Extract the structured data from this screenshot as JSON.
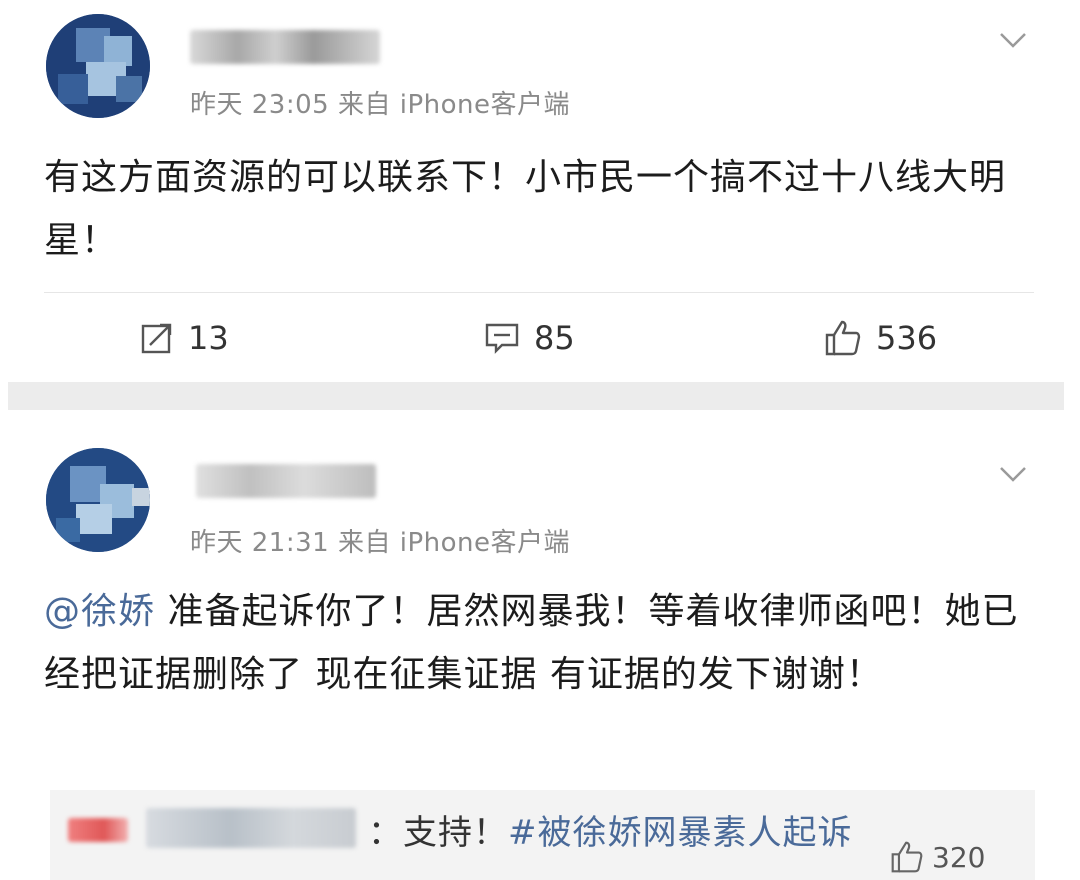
{
  "posts": [
    {
      "meta": "昨天 23:05  来自 iPhone客户端",
      "body": "有这方面资源的可以联系下！小市民一个搞不过十八线大明星！",
      "actions": {
        "repost_count": "13",
        "comment_count": "85",
        "like_count": "536"
      }
    },
    {
      "meta": "昨天 21:31  来自 iPhone客户端",
      "mention": "@徐娇",
      "body": " 准备起诉你了！居然网暴我！等着收律师函吧！她已经把证据删除了 现在征集证据 有证据的发下谢谢！",
      "comment_preview": {
        "text": "：支持！",
        "hashtag": "#被徐娇网暴素人起诉",
        "like_count": "320"
      }
    }
  ],
  "icons": {
    "chevron": "chevron-down-icon",
    "repost": "repost-icon",
    "comment": "comment-icon",
    "like": "thumbs-up-icon"
  },
  "colors": {
    "meta_gray": "#8a8a8a",
    "mention_blue": "#4a6a99",
    "divider": "#ececec"
  }
}
